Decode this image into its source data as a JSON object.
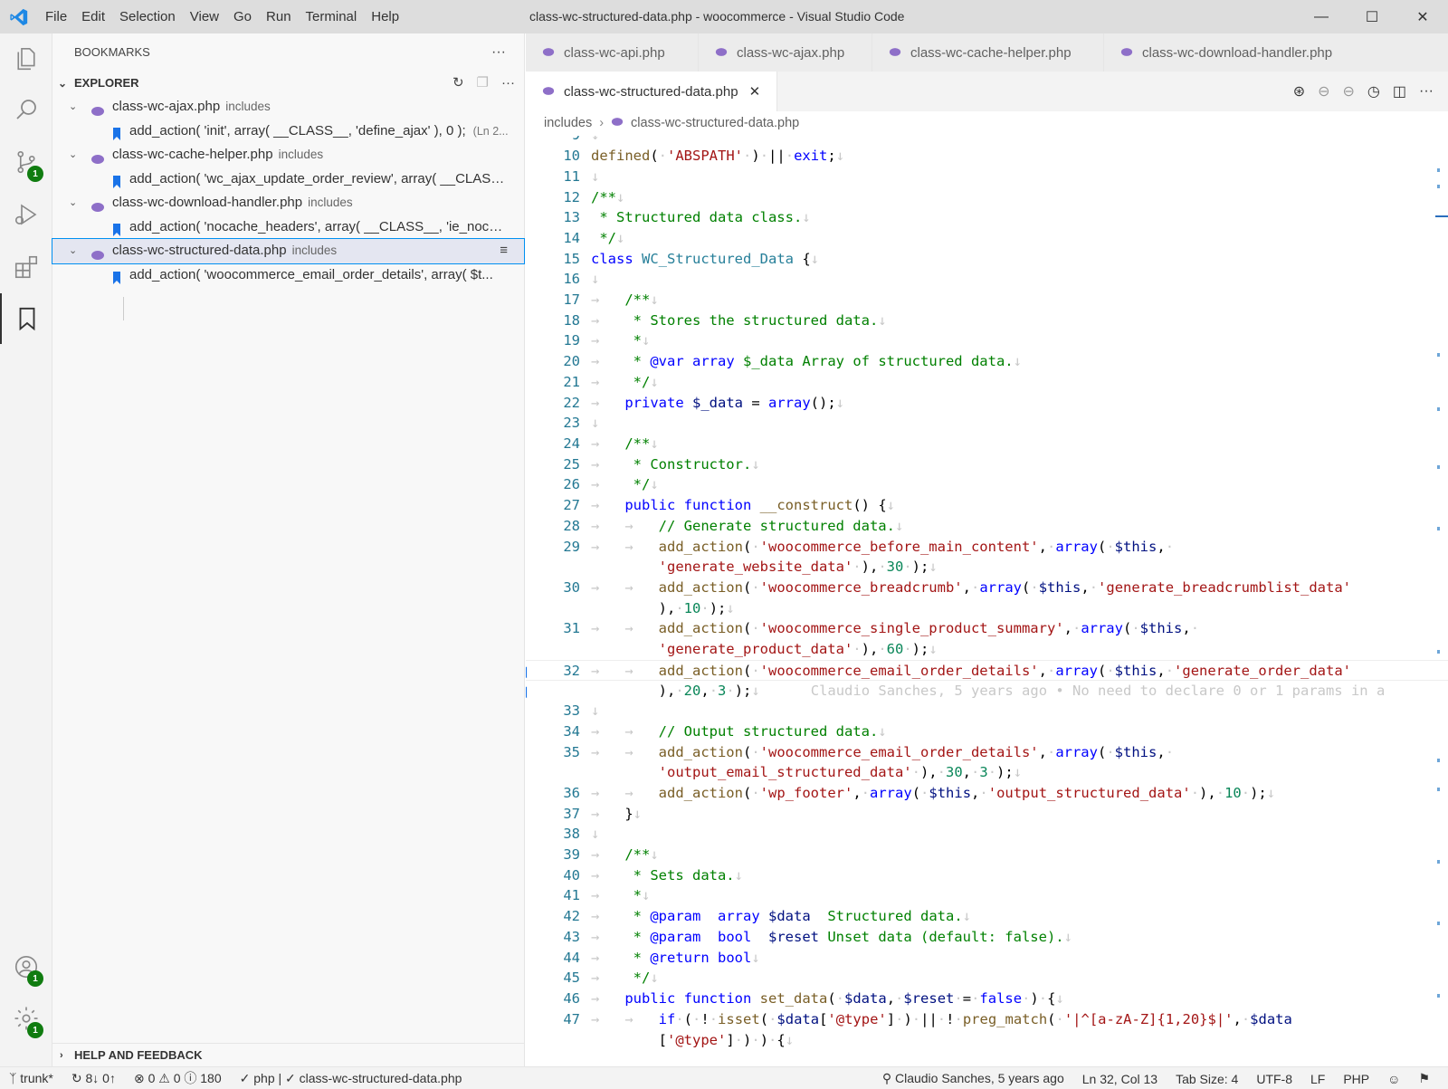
{
  "window": {
    "title": "class-wc-structured-data.php - woocommerce - Visual Studio Code",
    "menu": [
      "File",
      "Edit",
      "Selection",
      "View",
      "Go",
      "Run",
      "Terminal",
      "Help"
    ]
  },
  "activity_bar": {
    "items": [
      "explorer-icon",
      "search-icon",
      "source-control-icon",
      "run-debug-icon",
      "extensions-icon",
      "bookmarks-icon"
    ],
    "source_control_badge": "1",
    "accounts_badge": "1",
    "settings_badge": "1"
  },
  "sidebar": {
    "title": "BOOKMARKS",
    "section": "EXPLORER",
    "help": "HELP AND FEEDBACK",
    "tree": [
      {
        "file": "class-wc-ajax.php",
        "desc": "includes",
        "bookmark": "add_action( 'init', array( __CLASS__, 'define_ajax' ), 0 );",
        "loc": "(Ln 2..."
      },
      {
        "file": "class-wc-cache-helper.php",
        "desc": "includes",
        "bookmark": "add_action( 'wc_ajax_update_order_review', array( __CLASS...",
        "loc": ""
      },
      {
        "file": "class-wc-download-handler.php",
        "desc": "includes",
        "bookmark": "add_action( 'nocache_headers', array( __CLASS__, 'ie_nocac...",
        "loc": ""
      },
      {
        "file": "class-wc-structured-data.php",
        "desc": "includes",
        "bookmark": "add_action( 'woocommerce_email_order_details', array( $t...",
        "loc": ""
      }
    ]
  },
  "editor": {
    "tabs_row1": [
      "class-wc-api.php",
      "class-wc-ajax.php",
      "class-wc-cache-helper.php",
      "class-wc-download-handler.php"
    ],
    "active_tab": "class-wc-structured-data.php",
    "breadcrumb": [
      "includes",
      "class-wc-structured-data.php"
    ],
    "blame": "Claudio Sanches, 5 years ago • No need to declare 0 or 1 params in a"
  },
  "status_bar": {
    "branch": "trunk*",
    "sync": "8↓ 0↑",
    "problems": "⊗ 0 ⚠ 0 ⓘ 180",
    "lang_check": "✓ php | ✓ class-wc-structured-data.php",
    "blame": "Claudio Sanches, 5 years ago",
    "position": "Ln 32, Col 13",
    "tab_size": "Tab Size: 4",
    "encoding": "UTF-8",
    "eol": "LF",
    "language": "PHP"
  }
}
